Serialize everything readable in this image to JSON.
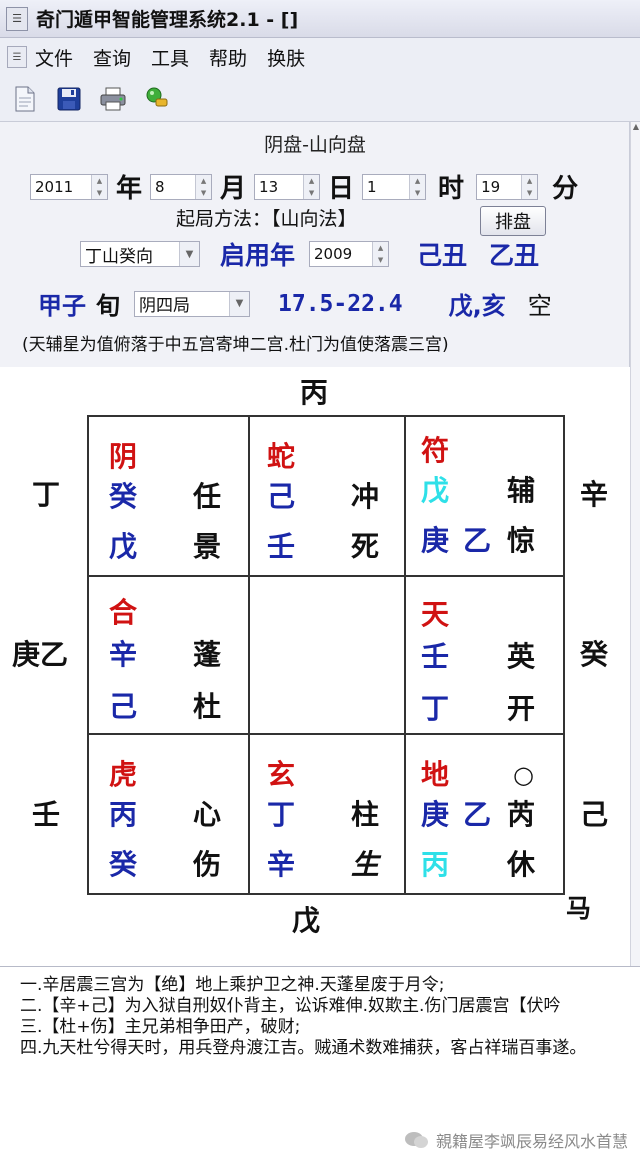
{
  "window": {
    "title": "奇门遁甲智能管理系统2.1 - []"
  },
  "menu": {
    "items": [
      "文件",
      "查询",
      "工具",
      "帮助",
      "换肤"
    ]
  },
  "toolbar": {
    "icons": [
      "new-file-icon",
      "save-icon",
      "print-icon",
      "tool-icon"
    ]
  },
  "panel": {
    "title": "阴盘-山向盘",
    "date": {
      "year": "2011",
      "year_label": "年",
      "month": "8",
      "month_label": "月",
      "day": "13",
      "day_label": "日",
      "hour": "1",
      "hour_label": "时",
      "minute": "19",
      "minute_label": "分"
    },
    "method_label": "起局方法：【山向法】",
    "pan_button": "排盘",
    "direction": "丁山癸向",
    "use_year_label": "启用年",
    "use_year": "2009",
    "ganzhi1": "己丑",
    "ganzhi2": "乙丑",
    "xun": "甲子",
    "xun_label": "旬",
    "ju": "阴四局",
    "range": "17.5-22.4",
    "kong_pair": "戊,亥",
    "kong_label": "空",
    "summary": "(天辅星为值俯落于中五宫寄坤二宫.杜门为值使落震三宫)"
  },
  "board": {
    "top": "丙",
    "bottom": "戊",
    "left": [
      "丁",
      "庚乙",
      "壬"
    ],
    "right": [
      "辛",
      "癸",
      "己"
    ],
    "ma": "马",
    "cells": {
      "nw": {
        "god": "阴",
        "tian": "癸",
        "star": "任",
        "di": "戊",
        "door": "景"
      },
      "n": {
        "god": "蛇",
        "tian": "己",
        "star": "冲",
        "di": "壬",
        "door": "死"
      },
      "ne": {
        "god": "符",
        "tian": "戊",
        "star": "辅",
        "di": "庚",
        "di2": "乙",
        "door": "惊"
      },
      "w": {
        "god": "合",
        "tian": "辛",
        "star": "蓬",
        "di": "己",
        "door": "杜"
      },
      "e": {
        "god": "天",
        "tian": "壬",
        "star": "英",
        "di": "丁",
        "door": "开"
      },
      "sw": {
        "god": "虎",
        "tian": "丙",
        "star": "心",
        "di": "癸",
        "door": "伤"
      },
      "s": {
        "god": "玄",
        "tian": "丁",
        "star": "柱",
        "di": "辛",
        "door": "生"
      },
      "se": {
        "god": "地",
        "mark": "○",
        "tian": "庚",
        "tian2": "乙",
        "star": "芮",
        "di": "丙",
        "door": "休"
      }
    }
  },
  "notes": [
    "一.辛居震三宫为【绝】地上乘护卫之神.天蓬星废于月令;",
    "二.【辛+己】为入狱自刑奴仆背主，讼诉难伸.奴欺主.伤门居震宫【伏吟",
    "三.【杜+伤】主兄弟相争田产，破财;",
    "四.九天杜兮得天时，用兵登舟渡江吉。贼通术数难捕获，客占祥瑞百事遂。"
  ],
  "watermark": "親籍屋李飒辰易经风水首慧",
  "colors": {
    "god": "#d01212",
    "stem": "#1a28a8",
    "highlight": "#2ee0e8"
  }
}
